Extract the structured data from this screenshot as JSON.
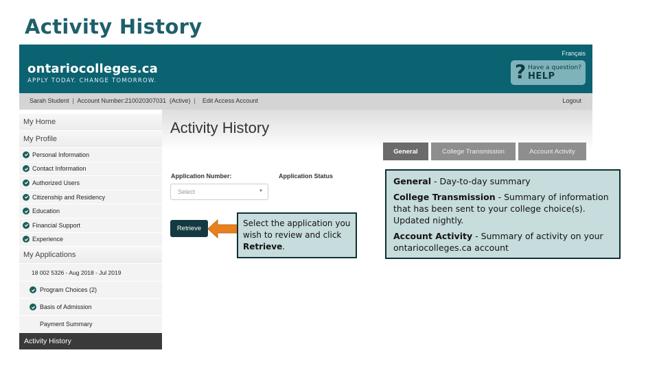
{
  "slide": {
    "title": "Activity History"
  },
  "header": {
    "brand": "ontariocolleges.ca",
    "tagline": "APPLY TODAY. CHANGE TOMORROW.",
    "language_link": "Français",
    "help": {
      "icon": "question-mark-icon",
      "small_text": "Have a question?",
      "big_text": "HELP"
    }
  },
  "account_bar": {
    "user_name": "Sarah Student",
    "account_number": "Account Number:210020307031",
    "account_status": "(Active)",
    "edit_link": "Edit Access Account",
    "logout": "Logout"
  },
  "sidebar": {
    "my_home": "My Home",
    "my_profile": "My Profile",
    "profile_items": [
      "Personal Information",
      "Contact Information",
      "Authorized Users",
      "Citizenship and Residency",
      "Education",
      "Financial Support",
      "Experience"
    ],
    "my_applications": "My Applications",
    "application": "18 002 5326 - Aug 2018 - Jul 2019",
    "application_items": [
      "Program Choices (2)",
      "Basis of Admission"
    ],
    "payment_summary": "Payment Summary",
    "activity_history": "Activity History"
  },
  "main": {
    "heading": "Activity History",
    "tabs": [
      {
        "label": "General",
        "active": true
      },
      {
        "label": "College Transmission",
        "active": false
      },
      {
        "label": "Account Activity",
        "active": false
      }
    ],
    "application_number_label": "Application Number:",
    "application_status_label": "Application Status",
    "select_value": "Select",
    "retrieve_label": "Retrieve"
  },
  "callouts": {
    "retrieve": {
      "text_before": "Select the application you wish to review and click ",
      "bold": "Retrieve",
      "text_after": "."
    },
    "tabs": [
      {
        "term": "General",
        "desc": " - Day-to-day summary"
      },
      {
        "term": "College Transmission",
        "desc": " - Summary of information that has been sent to your college choice(s). Updated nightly."
      },
      {
        "term": "Account Activity",
        "desc": " - Summary of activity on your ontariocolleges.ca account"
      }
    ]
  },
  "colors": {
    "brand_teal": "#0b6270",
    "title_teal": "#1f5f6b",
    "arrow_orange": "#e8801f",
    "callout_bg": "#c7dcdc",
    "check_green": "#1b5e5a"
  }
}
